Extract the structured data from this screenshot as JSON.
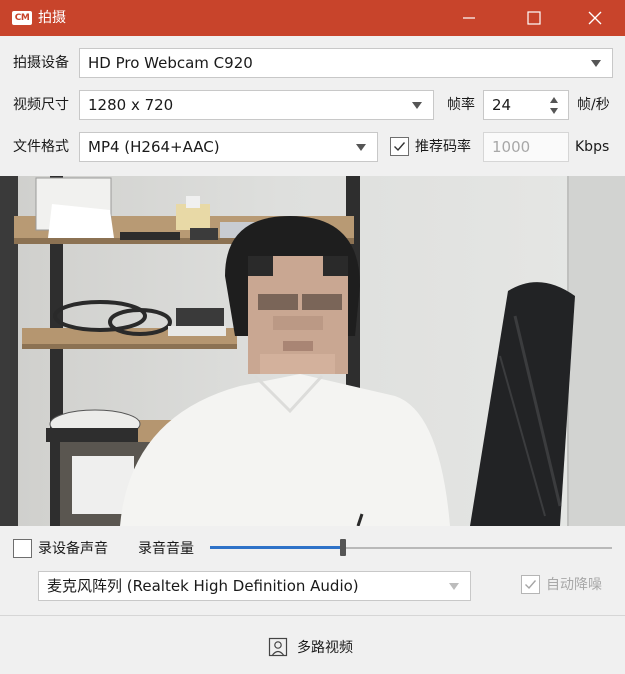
{
  "window": {
    "title": "拍摄",
    "logo_text": "CM",
    "accent_color": "#c8442b",
    "controls": [
      "minimize-icon",
      "maximize-icon",
      "close-icon"
    ]
  },
  "device": {
    "label": "拍摄设备",
    "value": "HD Pro Webcam C920"
  },
  "resolution": {
    "label": "视频尺寸",
    "value": "1280 x 720"
  },
  "framerate": {
    "label": "帧率",
    "value": "24",
    "unit": "帧/秒"
  },
  "format": {
    "label": "文件格式",
    "value": "MP4 (H264+AAC)"
  },
  "bitrate": {
    "recommend_label": "推荐码率",
    "recommend_checked": true,
    "value": "1000",
    "unit": "Kbps"
  },
  "audio": {
    "record_device_label": "录设备声音",
    "record_device_checked": false,
    "volume_label": "录音音量",
    "volume_level": 0.33,
    "mic_value": "麦克风阵列 (Realtek High Definition Audio)",
    "auto_denoise_label": "自动降噪",
    "auto_denoise_checked": true,
    "slider_color": "#2e72c8"
  },
  "footer": {
    "multi_video_label": "多路视频",
    "multi_video_icon": "person-portrait-icon"
  }
}
